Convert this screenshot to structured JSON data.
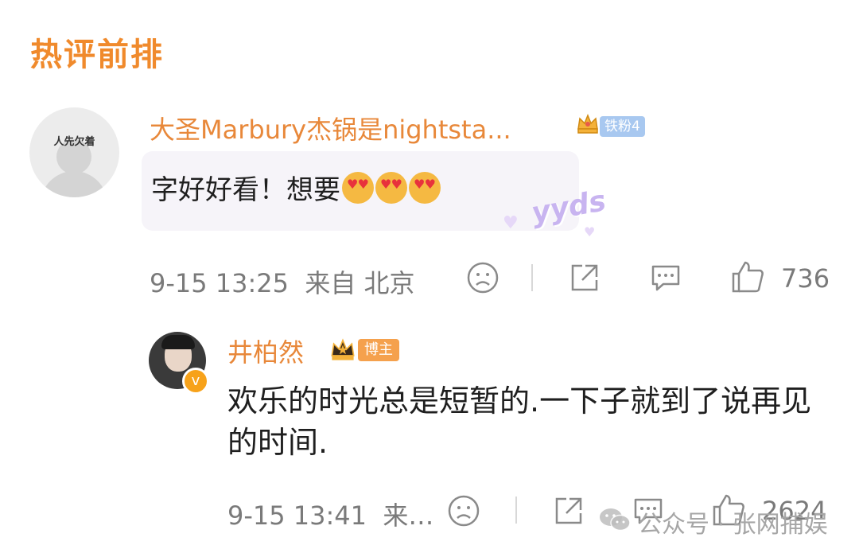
{
  "section_title": "热评前排",
  "comment": {
    "avatar_caption": "人先欠着",
    "username": "大圣Marbury杰锅是nightsta...",
    "fan_badge": "铁粉4",
    "text": "字好好看！想要",
    "sticker": "yyds",
    "time": "9-15 13:25",
    "source": "来自 北京",
    "like_count": "736"
  },
  "reply": {
    "username": "井柏然",
    "role_badge": "博主",
    "verified_mark": "v",
    "text": "欢乐的时光总是短暂的.一下子就到了说再见的时间.",
    "time": "9-15 13:41",
    "source": "来…",
    "like_count": "2624"
  },
  "watermark": "公众号 · 张网捕娱",
  "colors": {
    "accent_orange": "#f08a2c",
    "username_orange": "#e8883a",
    "meta_gray": "#7a7a7a",
    "fan_badge_blue": "#a8c8f0",
    "blogger_badge_orange": "#f5a14d"
  },
  "icons": [
    "frown-icon",
    "share-icon",
    "comment-icon",
    "like-icon",
    "crown-icon",
    "verified-icon",
    "wechat-icon"
  ]
}
